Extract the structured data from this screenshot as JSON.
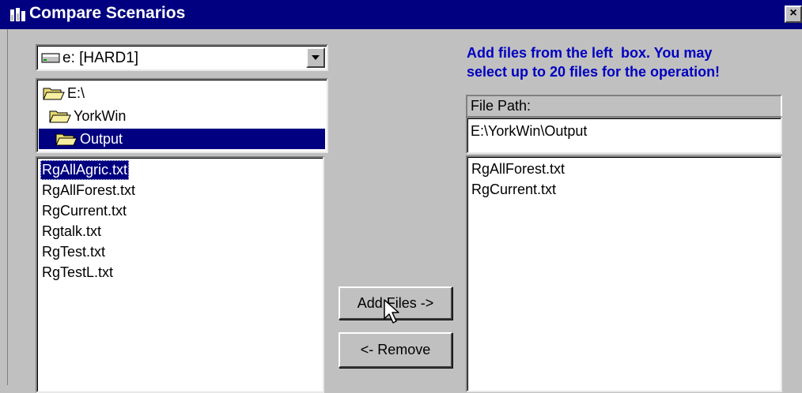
{
  "window": {
    "title": "Compare Scenarios",
    "close_label": "×",
    "app_icon": "app-icon",
    "close_icon": "close-icon"
  },
  "drive_select": {
    "icon": "hard-drive-icon",
    "value": "e: [HARD1]",
    "dropdown_icon": "chevron-down-icon"
  },
  "directory_tree": {
    "items": [
      {
        "label": "E:\\",
        "icon": "open-folder-icon",
        "selected": false
      },
      {
        "label": "YorkWin",
        "icon": "open-folder-icon",
        "selected": false
      },
      {
        "label": "Output",
        "icon": "open-folder-icon",
        "selected": true
      }
    ]
  },
  "source_files": {
    "items": [
      {
        "label": "RgAllAgric.txt",
        "selected": true
      },
      {
        "label": "RgAllForest.txt",
        "selected": false
      },
      {
        "label": "RgCurrent.txt",
        "selected": false
      },
      {
        "label": "Rgtalk.txt",
        "selected": false
      },
      {
        "label": "RgTest.txt",
        "selected": false
      },
      {
        "label": "RgTestL.txt",
        "selected": false
      }
    ]
  },
  "instructions": {
    "line1": "Add files from the left  box. You may",
    "line2": "select up to 20 files for the operation!"
  },
  "file_path": {
    "label": "File Path:",
    "value": "E:\\YorkWin\\Output"
  },
  "selected_files": {
    "items": [
      {
        "label": "RgAllForest.txt"
      },
      {
        "label": "RgCurrent.txt"
      }
    ]
  },
  "buttons": {
    "add_label": "Add Files ->",
    "remove_label": "<- Remove"
  },
  "cursor": {
    "icon": "mouse-pointer-icon"
  },
  "colors": {
    "title_bar": "#000080",
    "selection": "#000080",
    "instruction_text": "#0000c0",
    "face": "#c0c0c0"
  }
}
